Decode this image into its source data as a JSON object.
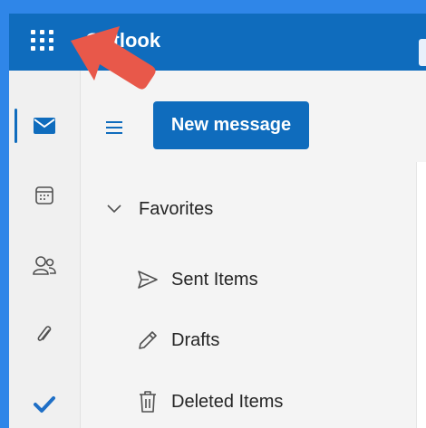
{
  "header": {
    "app_title": "Outlook"
  },
  "rail": {
    "items": [
      {
        "icon": "mail-icon",
        "active": true
      },
      {
        "icon": "calendar-icon",
        "active": false
      },
      {
        "icon": "people-icon",
        "active": false
      },
      {
        "icon": "attachment-icon",
        "active": false
      },
      {
        "icon": "todo-check-icon",
        "active": false
      }
    ]
  },
  "toolbar": {
    "new_message_label": "New message"
  },
  "folders": {
    "favorites_label": "Favorites",
    "items": [
      {
        "label": "Sent Items",
        "icon": "send-icon"
      },
      {
        "label": "Drafts",
        "icon": "pencil-icon"
      },
      {
        "label": "Deleted Items",
        "icon": "trash-icon"
      }
    ]
  },
  "colors": {
    "brand": "#0f6cbd",
    "annotation_arrow": "#e8584a",
    "background": "#2f86e8"
  }
}
